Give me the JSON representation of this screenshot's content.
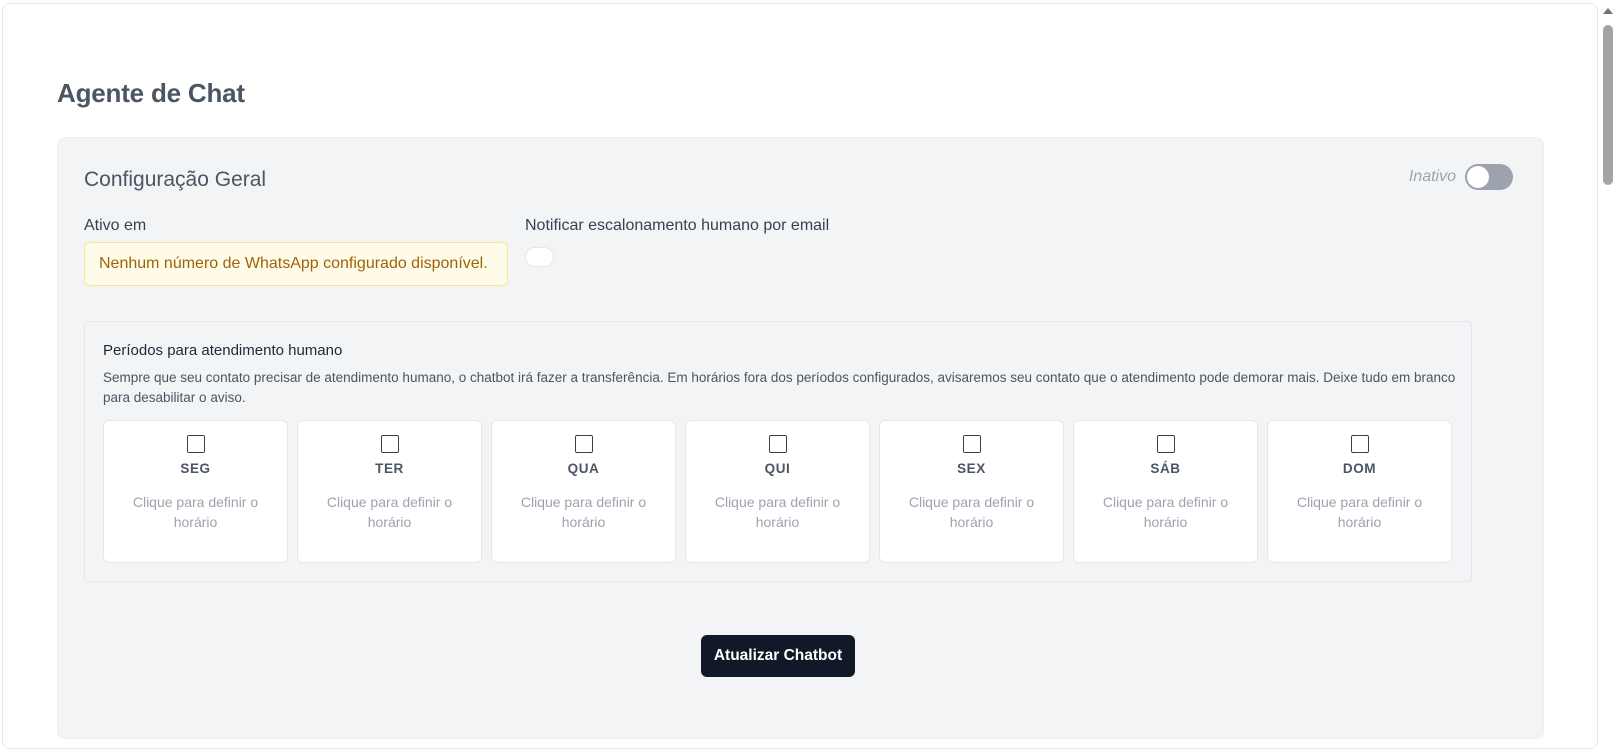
{
  "page": {
    "title": "Agente de Chat"
  },
  "general": {
    "title": "Configuração Geral",
    "status_label": "Inativo",
    "active_on_label": "Ativo em",
    "active_on_warning": "Nenhum número de WhatsApp configurado disponível.",
    "notify_label": "Notificar escalonamento humano por email"
  },
  "periods": {
    "title": "Períodos para atendimento humano",
    "description": "Sempre que seu contato precisar de atendimento humano, o chatbot irá fazer a transferência. Em horários fora dos períodos configurados, avisaremos seu contato que o atendimento pode demorar mais. Deixe tudo em branco para desabilitar o aviso.",
    "days": [
      {
        "name": "SEG",
        "hint": "Clique para definir o horário"
      },
      {
        "name": "TER",
        "hint": "Clique para definir o horário"
      },
      {
        "name": "QUA",
        "hint": "Clique para definir o horário"
      },
      {
        "name": "QUI",
        "hint": "Clique para definir o horário"
      },
      {
        "name": "SEX",
        "hint": "Clique para definir o horário"
      },
      {
        "name": "SÁB",
        "hint": "Clique para definir o horário"
      },
      {
        "name": "DOM",
        "hint": "Clique para definir o horário"
      }
    ]
  },
  "actions": {
    "update_label": "Atualizar Chatbot"
  },
  "colors": {
    "button_bg": "#111827",
    "warning_text": "#a16207",
    "toggle_off": "#9ca3af"
  }
}
